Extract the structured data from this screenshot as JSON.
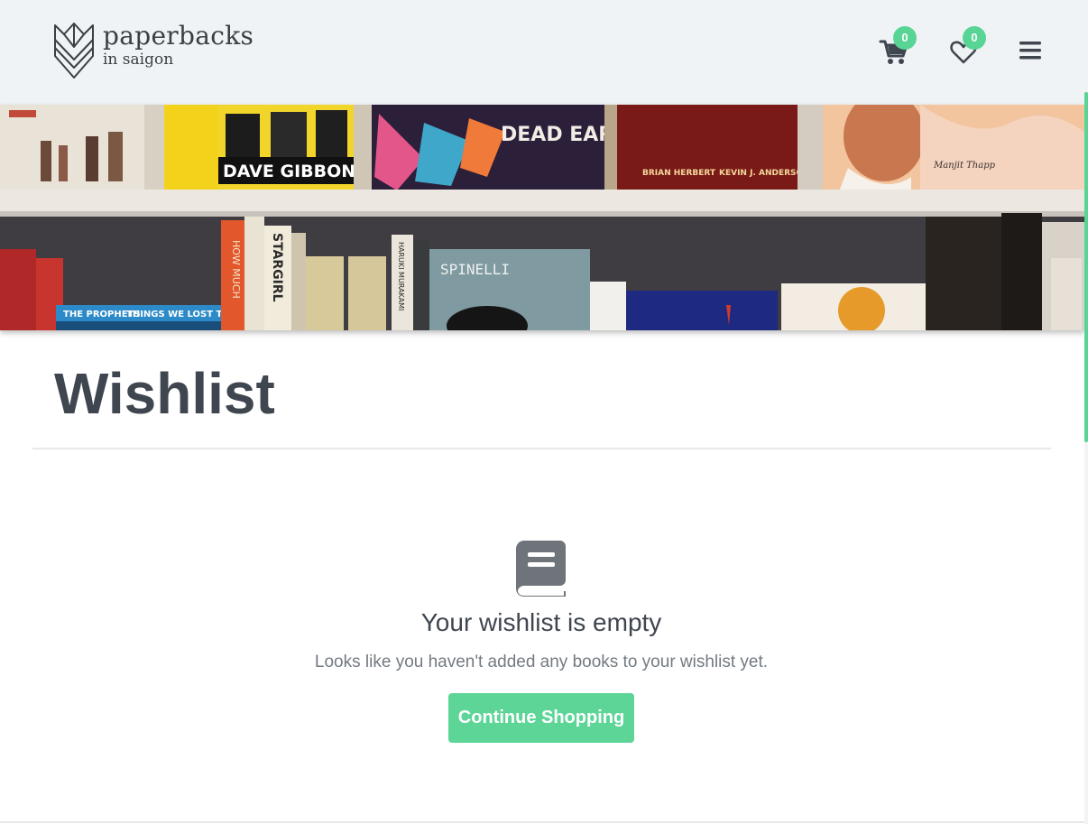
{
  "header": {
    "logo": {
      "name": "paperbacks",
      "subtitle": "in saigon",
      "icon": "paperback-leaf-logo-icon"
    },
    "cart": {
      "icon": "shopping-cart-icon",
      "count": "0"
    },
    "wishlist": {
      "icon": "heart-icon",
      "count": "0"
    },
    "menu": {
      "icon": "hamburger-menu-icon"
    }
  },
  "hero": {
    "visible_text": [
      "DAVE GIBBONS",
      "DEAD EARTH",
      "BRIAN HERBERT",
      "KEVIN J. ANDERSON",
      "Manjit Thapp",
      "THE PROPHETS",
      "THINGS WE LOST TO THE WATER",
      "SPINELLI",
      "STARGIRL",
      "HOW MUCH",
      "HARUKI MURAKAMI"
    ]
  },
  "main": {
    "title": "Wishlist",
    "empty_state": {
      "icon": "book-icon",
      "heading": "Your wishlist is empty",
      "message": "Looks like you haven't added any books to your wishlist yet.",
      "button_label": "Continue Shopping"
    }
  },
  "colors": {
    "accent": "#5cd597",
    "header_bg": "#f0f3f5",
    "text_dark": "#3f464f",
    "text_muted": "#737a82"
  }
}
